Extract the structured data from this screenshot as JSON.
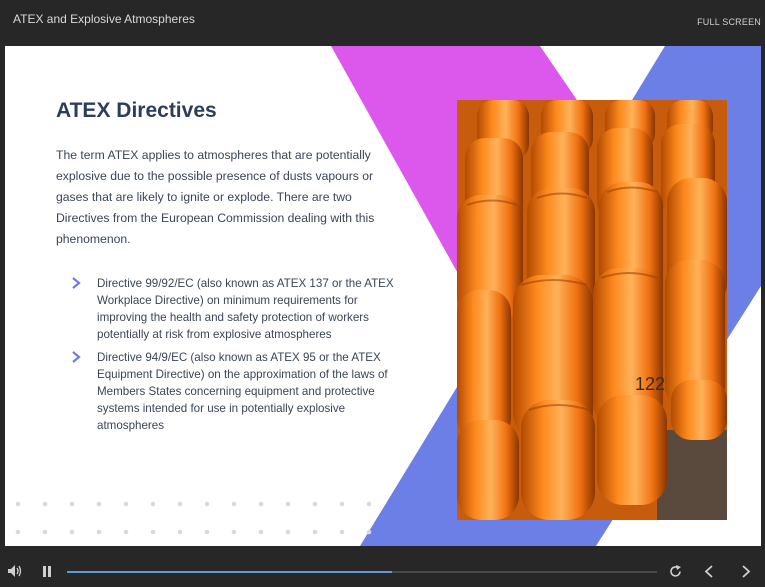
{
  "header": {
    "course_title": "ATEX and Explosive Atmospheres",
    "fullscreen_label": "FULL SCREEN"
  },
  "slide": {
    "heading": "ATEX Directives",
    "intro": "The term ATEX applies to atmospheres that are potentially explosive due to the possible presence of dusts vapours or gases that are likely to ignite or explode. There are two Directives from the European Commission dealing with this phenomenon.",
    "bullets": [
      {
        "text": "Directive 99/92/EC (also known as  ATEX 137 or the ATEX Workplace Directive) on minimum requirements for improving the health and safety protection of workers potentially at risk from explosive atmospheres"
      },
      {
        "text": "Directive 94/9/EC (also known as ATEX 95 or the ATEX Equipment Directive) on the approximation of the laws of Members States concerning equipment and protective systems intended for use in potentially explosive atmospheres"
      }
    ],
    "image": {
      "subject": "orange gas cylinders",
      "cylinder_marking": "122"
    },
    "colors": {
      "heading": "#2c3e5c",
      "magenta": "#dc58ec",
      "blue": "#6b7fe6",
      "bullet": "#6b7fe6"
    }
  },
  "player": {
    "progress": 0.55,
    "icons": [
      "volume-icon",
      "pause-icon",
      "replay-icon",
      "previous-icon",
      "next-icon"
    ]
  }
}
